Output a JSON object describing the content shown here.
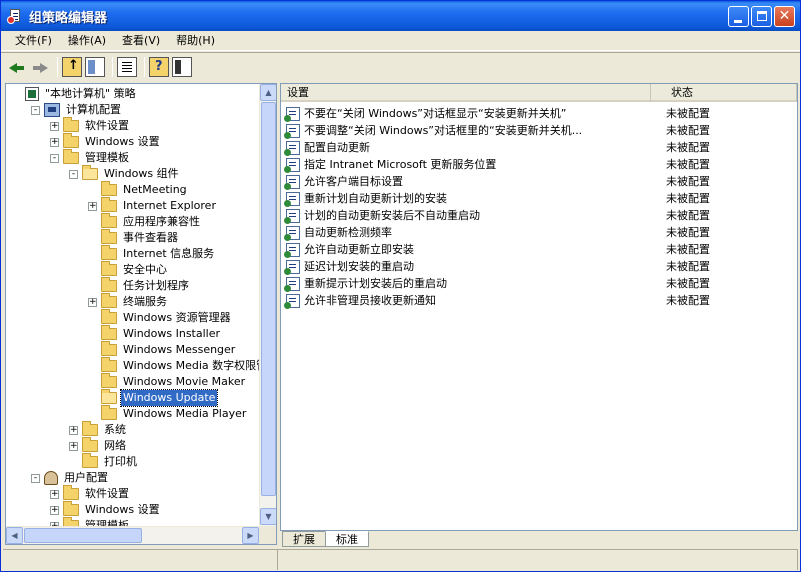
{
  "window": {
    "title": "组策略编辑器"
  },
  "menu": [
    "文件(F)",
    "操作(A)",
    "查看(V)",
    "帮助(H)"
  ],
  "toolbar": {
    "icons": [
      "back-icon",
      "forward-icon",
      "up-folder-icon",
      "show-hide-tree-icon",
      "export-list-icon",
      "help-icon",
      "properties-pane-icon"
    ]
  },
  "tree": {
    "items": [
      {
        "label": "\"本地计算机\" 策略",
        "indent": 0,
        "icon": "policy-root-icon",
        "expander": "none"
      },
      {
        "label": "计算机配置",
        "indent": 1,
        "icon": "computer-icon",
        "expander": "-"
      },
      {
        "label": "软件设置",
        "indent": 2,
        "icon": "folder-icon",
        "expander": "+"
      },
      {
        "label": "Windows 设置",
        "indent": 2,
        "icon": "folder-icon",
        "expander": "+"
      },
      {
        "label": "管理模板",
        "indent": 2,
        "icon": "folder-icon",
        "expander": "-"
      },
      {
        "label": "Windows 组件",
        "indent": 3,
        "icon": "folder-open-icon",
        "expander": "-"
      },
      {
        "label": "NetMeeting",
        "indent": 4,
        "icon": "folder-icon",
        "expander": "none"
      },
      {
        "label": "Internet Explorer",
        "indent": 4,
        "icon": "folder-icon",
        "expander": "+"
      },
      {
        "label": "应用程序兼容性",
        "indent": 4,
        "icon": "folder-icon",
        "expander": "none"
      },
      {
        "label": "事件查看器",
        "indent": 4,
        "icon": "folder-icon",
        "expander": "none"
      },
      {
        "label": "Internet 信息服务",
        "indent": 4,
        "icon": "folder-icon",
        "expander": "none"
      },
      {
        "label": "安全中心",
        "indent": 4,
        "icon": "folder-icon",
        "expander": "none"
      },
      {
        "label": "任务计划程序",
        "indent": 4,
        "icon": "folder-icon",
        "expander": "none"
      },
      {
        "label": "终端服务",
        "indent": 4,
        "icon": "folder-icon",
        "expander": "+"
      },
      {
        "label": "Windows 资源管理器",
        "indent": 4,
        "icon": "folder-icon",
        "expander": "none"
      },
      {
        "label": "Windows Installer",
        "indent": 4,
        "icon": "folder-icon",
        "expander": "none"
      },
      {
        "label": "Windows Messenger",
        "indent": 4,
        "icon": "folder-icon",
        "expander": "none"
      },
      {
        "label": "Windows Media 数字权限管理",
        "indent": 4,
        "icon": "folder-icon",
        "expander": "none"
      },
      {
        "label": "Windows Movie Maker",
        "indent": 4,
        "icon": "folder-icon",
        "expander": "none"
      },
      {
        "label": "Windows Update",
        "indent": 4,
        "icon": "folder-open-icon",
        "expander": "none",
        "selected": true
      },
      {
        "label": "Windows Media Player",
        "indent": 4,
        "icon": "folder-icon",
        "expander": "none"
      },
      {
        "label": "系统",
        "indent": 3,
        "icon": "folder-icon",
        "expander": "+"
      },
      {
        "label": "网络",
        "indent": 3,
        "icon": "folder-icon",
        "expander": "+"
      },
      {
        "label": "打印机",
        "indent": 3,
        "icon": "folder-icon",
        "expander": "none"
      },
      {
        "label": "用户配置",
        "indent": 1,
        "icon": "user-icon",
        "expander": "-"
      },
      {
        "label": "软件设置",
        "indent": 2,
        "icon": "folder-icon",
        "expander": "+"
      },
      {
        "label": "Windows 设置",
        "indent": 2,
        "icon": "folder-icon",
        "expander": "+"
      },
      {
        "label": "管理模板",
        "indent": 2,
        "icon": "folder-icon",
        "expander": "+"
      }
    ]
  },
  "list": {
    "columns": [
      "设置",
      "状态"
    ],
    "rows": [
      {
        "name": "不要在“关闭 Windows”对话框显示“安装更新并关机”",
        "state": "未被配置"
      },
      {
        "name": "不要调整“关闭 Windows”对话框里的“安装更新并关机...",
        "state": "未被配置"
      },
      {
        "name": "配置自动更新",
        "state": "未被配置"
      },
      {
        "name": "指定 Intranet Microsoft 更新服务位置",
        "state": "未被配置"
      },
      {
        "name": "允许客户端目标设置",
        "state": "未被配置"
      },
      {
        "name": "重新计划自动更新计划的安装",
        "state": "未被配置"
      },
      {
        "name": "计划的自动更新安装后不自动重启动",
        "state": "未被配置"
      },
      {
        "name": "自动更新检测频率",
        "state": "未被配置"
      },
      {
        "name": "允许自动更新立即安装",
        "state": "未被配置"
      },
      {
        "name": "延迟计划安装的重启动",
        "state": "未被配置"
      },
      {
        "name": "重新提示计划安装后的重启动",
        "state": "未被配置"
      },
      {
        "name": "允许非管理员接收更新通知",
        "state": "未被配置"
      }
    ]
  },
  "tabs": [
    {
      "label": "扩展",
      "active": false
    },
    {
      "label": "标准",
      "active": true
    }
  ],
  "colors": {
    "titlebar": "#0a5fe0",
    "selection": "#316ac5",
    "folder": "#f5d36b"
  }
}
